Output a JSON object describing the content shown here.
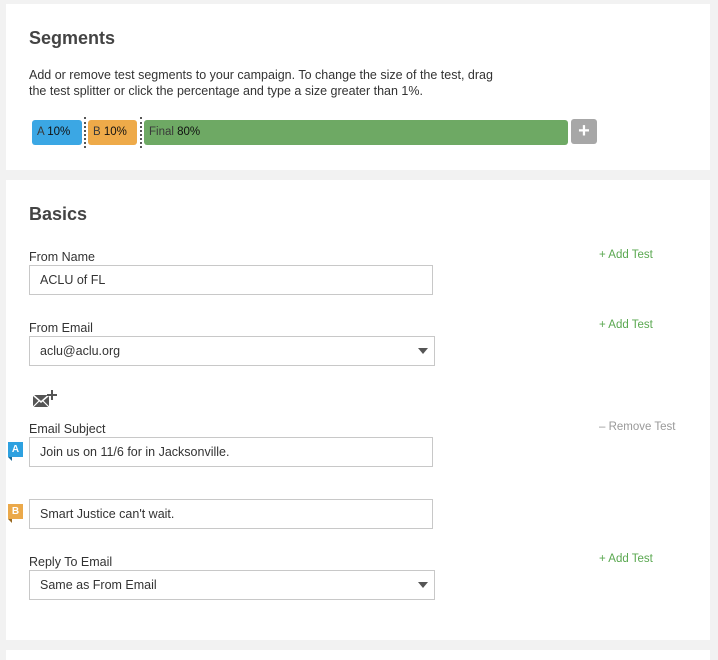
{
  "segments": {
    "title": "Segments",
    "description": "Add or remove test segments to your campaign. To change the size of the test, drag the test splitter or click the percentage and type a size greater than 1%.",
    "items": [
      {
        "label": "A",
        "percent": "10%",
        "color": "#3ba7e4"
      },
      {
        "label": "B",
        "percent": "10%",
        "color": "#eeaa49"
      },
      {
        "label": "Final",
        "percent": "80%",
        "color": "#6ea964"
      }
    ],
    "add_label": "+"
  },
  "basics": {
    "title": "Basics",
    "from_name": {
      "label": "From Name",
      "value": "ACLU of FL",
      "add_test": "+ Add Test"
    },
    "from_email": {
      "label": "From Email",
      "value": "aclu@aclu.org",
      "add_test": "+ Add Test"
    },
    "email_subject": {
      "label": "Email Subject",
      "remove_test": "– Remove Test",
      "variants": [
        {
          "badge": "A",
          "value": "Join us on 11/6 for in Jacksonville."
        },
        {
          "badge": "B",
          "value": "Smart Justice can't wait."
        }
      ]
    },
    "reply_to": {
      "label": "Reply To Email",
      "value": "Same as From Email",
      "add_test": "+ Add Test"
    }
  },
  "icons": {
    "mail_add": "mail-add-icon",
    "dropdown": "chevron-down-icon"
  }
}
